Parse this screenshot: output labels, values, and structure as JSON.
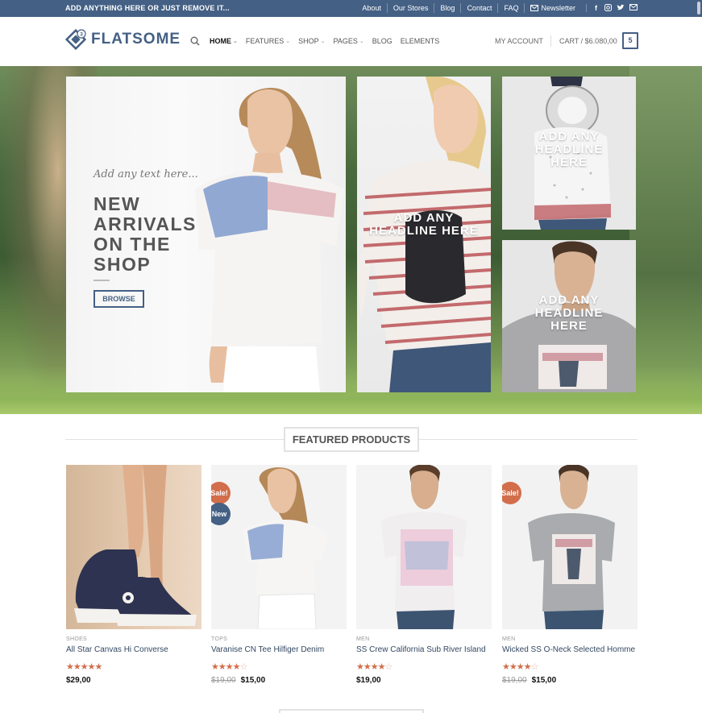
{
  "topbar": {
    "promo": "ADD ANYTHING HERE OR JUST REMOVE IT...",
    "links": [
      "About",
      "Our Stores",
      "Blog",
      "Contact",
      "FAQ"
    ],
    "newsletter": "Newsletter",
    "social_icons": [
      "facebook-icon",
      "instagram-icon",
      "twitter-icon",
      "email-icon"
    ]
  },
  "header": {
    "logo_text": "FLATSOME",
    "logo_badge": "3",
    "nav": [
      {
        "label": "HOME",
        "dropdown": true,
        "active": true
      },
      {
        "label": "FEATURES",
        "dropdown": true
      },
      {
        "label": "SHOP",
        "dropdown": true
      },
      {
        "label": "PAGES",
        "dropdown": true
      },
      {
        "label": "BLOG",
        "dropdown": false
      },
      {
        "label": "ELEMENTS",
        "dropdown": false
      }
    ],
    "account": "MY ACCOUNT",
    "cart_label": "CART / $6.080,00",
    "cart_count": "5"
  },
  "hero": {
    "main": {
      "lead": "Add any text here...",
      "headline": "NEW ARRIVALS ON THE SHOP",
      "button": "BROWSE"
    },
    "mid": {
      "headline": "ADD ANY HEADLINE HERE"
    },
    "top_right": {
      "headline": "ADD ANY HEADLINE HERE"
    },
    "bottom_right": {
      "headline": "ADD ANY HEADLINE HERE"
    }
  },
  "featured": {
    "title": "FEATURED PRODUCTS",
    "products": [
      {
        "category": "SHOES",
        "name": "All Star Canvas Hi Converse",
        "rating": 5,
        "price": "$29,00",
        "old_price": "",
        "badges": []
      },
      {
        "category": "TOPS",
        "name": "Varanise CN Tee Hilfiger Denim",
        "rating": 4,
        "price": "$15,00",
        "old_price": "$19,00",
        "badges": [
          "Sale!",
          "New"
        ]
      },
      {
        "category": "MEN",
        "name": "SS Crew California Sub River Island",
        "rating": 4,
        "price": "$19,00",
        "old_price": "",
        "badges": []
      },
      {
        "category": "MEN",
        "name": "Wicked SS O-Neck Selected Homme",
        "rating": 4,
        "price": "$15,00",
        "old_price": "$19,00",
        "badges": [
          "Sale!"
        ]
      }
    ]
  },
  "colors": {
    "primary": "#446084",
    "sale": "#d26e4b",
    "link": "#334862"
  }
}
